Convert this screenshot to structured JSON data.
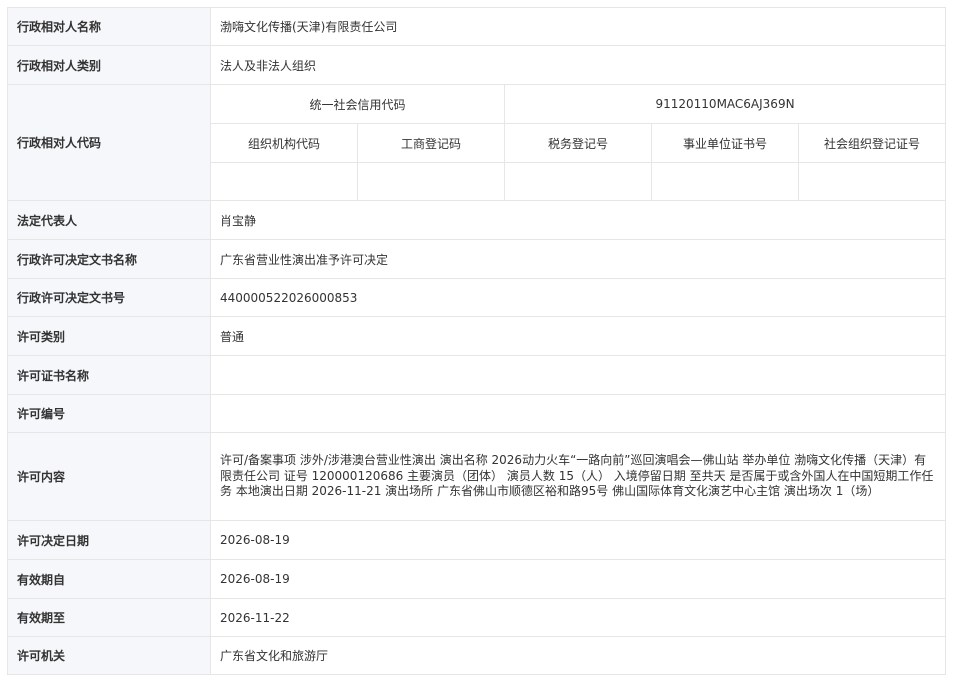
{
  "rows": {
    "name": {
      "label": "行政相对人名称",
      "value": "渤嗨文化传播(天津)有限责任公司"
    },
    "category": {
      "label": "行政相对人类别",
      "value": "法人及非法人组织"
    },
    "code_label": "行政相对人代码",
    "codes": {
      "credit_code_label": "统一社会信用代码",
      "credit_code_value": "91120110MAC6AJ369N",
      "headers": [
        "组织机构代码",
        "工商登记码",
        "税务登记号",
        "事业单位证书号",
        "社会组织登记证号"
      ],
      "values": [
        "",
        "",
        "",
        "",
        ""
      ]
    },
    "legal_rep": {
      "label": "法定代表人",
      "value": "肖宝静"
    },
    "doc_name": {
      "label": "行政许可决定文书名称",
      "value": "广东省营业性演出准予许可决定"
    },
    "doc_no": {
      "label": "行政许可决定文书号",
      "value": "440000522026000853"
    },
    "permit_type": {
      "label": "许可类别",
      "value": "普通"
    },
    "cert_name": {
      "label": "许可证书名称",
      "value": ""
    },
    "permit_no": {
      "label": "许可编号",
      "value": ""
    },
    "content": {
      "label": "许可内容",
      "value": "许可/备案事项 涉外/涉港澳台营业性演出 演出名称 2026动力火车“一路向前”巡回演唱会—佛山站 举办单位 渤嗨文化传播（天津）有限责任公司 证号 120000120686 主要演员（团体） 演员人数 15（人） 入境停留日期 至共天 是否属于或含外国人在中国短期工作任务 本地演出日期 2026-11-21 演出场所 广东省佛山市顺德区裕和路95号 佛山国际体育文化演艺中心主馆 演出场次 1（场）"
    },
    "decision_date": {
      "label": "许可决定日期",
      "value": "2026-08-19"
    },
    "valid_from": {
      "label": "有效期自",
      "value": "2026-08-19"
    },
    "valid_to": {
      "label": "有效期至",
      "value": "2026-11-22"
    },
    "authority": {
      "label": "许可机关",
      "value": "广东省文化和旅游厅"
    }
  }
}
